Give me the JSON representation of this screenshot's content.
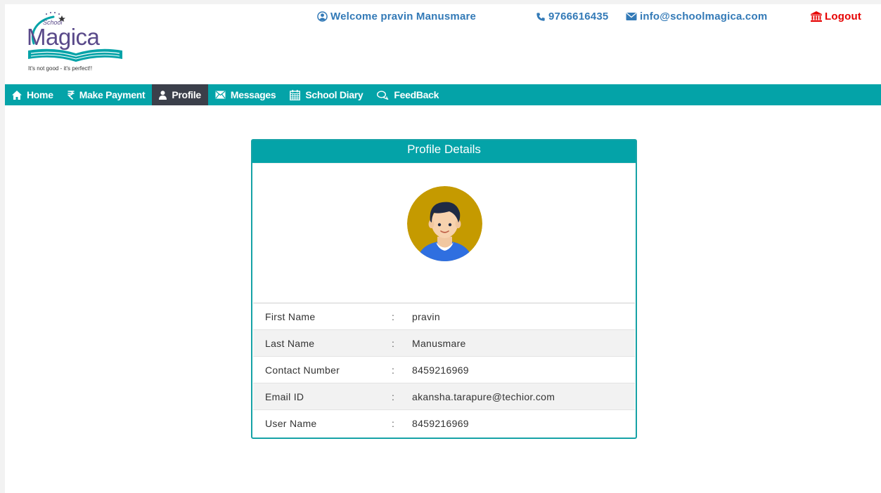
{
  "brand": {
    "name_small": "School",
    "name_large": "Magica",
    "tagline": "It's not good - it's perfect!!"
  },
  "top_bar": {
    "welcome": "Welcome pravin Manusmare",
    "phone": "9766616435",
    "email": "info@schoolmagica.com",
    "logout": "Logout"
  },
  "nav": {
    "items": [
      {
        "label": "Home",
        "icon": "home-icon"
      },
      {
        "label": "Make Payment",
        "icon": "rupee-icon"
      },
      {
        "label": "Profile",
        "icon": "user-icon",
        "active": true
      },
      {
        "label": "Messages",
        "icon": "envelope-icon"
      },
      {
        "label": "School Diary",
        "icon": "calendar-icon"
      },
      {
        "label": "FeedBack",
        "icon": "chat-icon"
      }
    ]
  },
  "profile": {
    "title": "Profile Details",
    "separator": ":",
    "rows": [
      {
        "label": "First Name",
        "value": "pravin"
      },
      {
        "label": "Last Name",
        "value": "Manusmare"
      },
      {
        "label": "Contact Number",
        "value": "8459216969"
      },
      {
        "label": "Email ID",
        "value": "akansha.tarapure@techior.com"
      },
      {
        "label": "User Name",
        "value": "8459216969"
      }
    ]
  },
  "colors": {
    "teal": "#04a3a8",
    "nav_active": "#3b3f4a",
    "link_blue": "#337ab7",
    "logout_red": "#e60000"
  }
}
